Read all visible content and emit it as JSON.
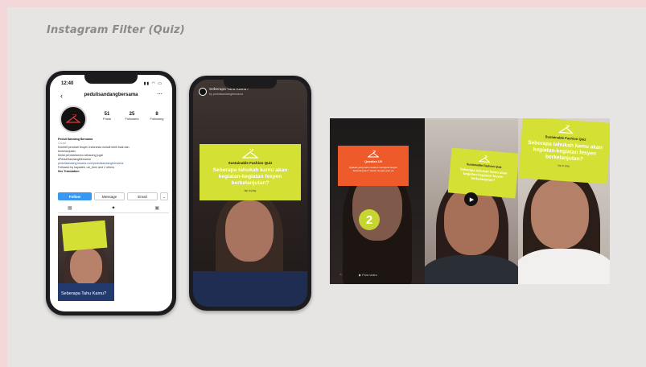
{
  "slide": {
    "title": "Instagram Filter (Quiz)"
  },
  "phone1": {
    "status_time": "12:40",
    "status_icons": "▮▮ ◠ ▭",
    "username": "pedulisandangbersama",
    "stats": [
      {
        "number": "51",
        "label": "Posts"
      },
      {
        "number": "25",
        "label": "Followers"
      },
      {
        "number": "8",
        "label": "Following"
      }
    ],
    "bio_name": "Peduli Sandang Bersama",
    "bio_category": "Cause",
    "bio_lines": [
      "Kolektif perubah fesyen Indonesia mulaill lebih baik dan",
      "berkelanjutan.",
      "Mulai perubahanmu sekarang juga!",
      "#PeduliSandangBersama"
    ],
    "bio_link": "pedulisandang.tesaria.com/pedulisandangbersama",
    "followed_by": "Followed by kayadek, uci_then and 2 others",
    "see_translation": "See Translation",
    "buttons": {
      "follow": "Follow",
      "message": "Message",
      "email": "Email",
      "dropdown": "⌄"
    },
    "post_caption": "Seberapa Tahu Kamu?"
  },
  "phone2": {
    "header": "Seberapa Tahu Kamu?",
    "subheader": "by pedulisandangbersama",
    "card_title": "Sustainable Fashion Quiz",
    "card_question": "Seberapa tahukah kamu akan kegiatan-kegiatan fesyen berkelanjutan?",
    "card_small": "tap to play"
  },
  "panel1": {
    "card_title": "Question 1/5",
    "card_desc": "Apakah yang kamu ketahui mengenai fesyen berkelanjutan? Jawab dengan jujur ya",
    "badge": "2",
    "bottom_left": "⌂",
    "bottom_right": "▶ Post video"
  },
  "panel2": {
    "card_title": "Sustainable Fashion Quiz",
    "card_question": "Seberapa tahukah kamu akan kegiatan-kegiatan fesyen berkelanjutan?",
    "play_glyph": "▶"
  },
  "panel3": {
    "card_title": "Sustainable Fashion Quiz",
    "card_question": "Seberapa tahukah kamu akan kegiatan-kegiatan fesyen berkelanjutan?",
    "card_small": "tap to play"
  }
}
